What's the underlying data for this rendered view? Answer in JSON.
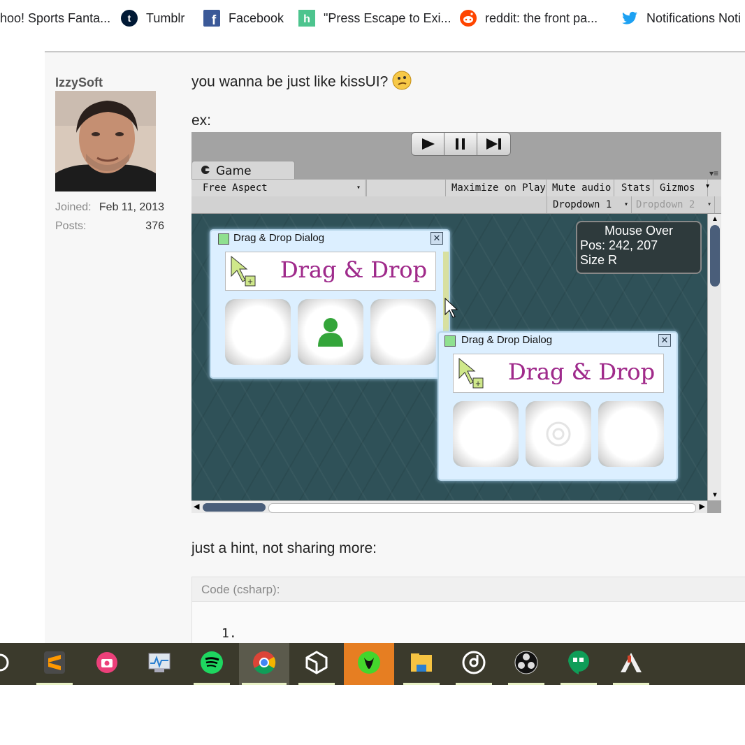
{
  "bookmarks": [
    {
      "label": "hoo! Sports Fanta...",
      "icon": "yahoo-icon"
    },
    {
      "label": "Tumblr",
      "icon": "tumblr-icon"
    },
    {
      "label": "Facebook",
      "icon": "facebook-icon"
    },
    {
      "label": "\"Press Escape to Exi...",
      "icon": "houzz-icon"
    },
    {
      "label": "reddit: the front pa...",
      "icon": "reddit-icon"
    },
    {
      "label": "Notifications Noti",
      "icon": "twitter-icon"
    }
  ],
  "author": {
    "username": "IzzySoft",
    "joined_label": "Joined:",
    "joined_value": "Feb 11, 2013",
    "posts_label": "Posts:",
    "posts_value": "376"
  },
  "post": {
    "line1": "you wanna be just like kissUI?",
    "line2": "ex:",
    "line3": "just a hint, not sharing more:",
    "code_header": "Code (csharp):",
    "code_line_number": "1."
  },
  "unity": {
    "tab_label": "Game",
    "aspect": "Free Aspect",
    "toolbar_buttons": [
      "Maximize on Play",
      "Mute audio",
      "Stats",
      "Gizmos"
    ],
    "dropdown1": "Dropdown 1",
    "dropdown2": "Dropdown 2",
    "mouse_over_title": "Mouse Over",
    "mouse_over_pos": "Pos: 242, 207",
    "mouse_over_size": "Size R",
    "dialog_title": "Drag & Drop Dialog",
    "banner_text": "Drag & Drop"
  },
  "taskbar": {
    "apps": [
      "cortana-icon",
      "sublime-text-icon",
      "screenshot-icon",
      "task-manager-icon",
      "spotify-icon",
      "chrome-icon",
      "unity-icon",
      "razer-icon",
      "file-explorer-icon",
      "groove-music-icon",
      "obs-icon",
      "hangouts-icon",
      "aseprite-icon"
    ]
  },
  "colors": {
    "forum_bg": "#f7f7f7",
    "taskbar_bg": "#3b3a2c",
    "viewport_bg": "#2f5158",
    "banner_text": "#a02a8a"
  }
}
